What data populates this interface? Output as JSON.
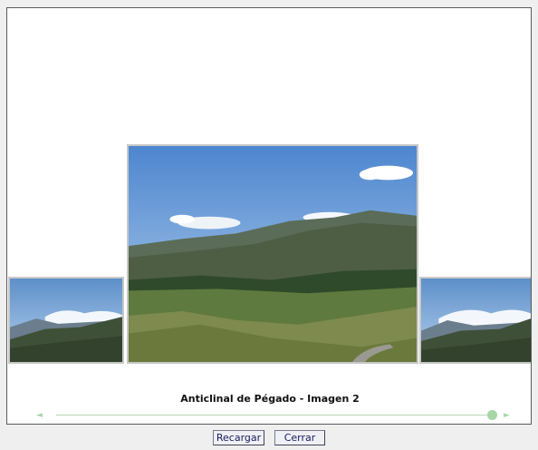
{
  "viewer": {
    "caption": "Anticlinal de Pégado - Imagen 2",
    "slider": {
      "position_fraction": 1.0,
      "prev_arrow": "◄",
      "next_arrow": "►"
    }
  },
  "photos": {
    "main": {
      "subject": "mountain landscape"
    },
    "prev": {
      "subject": "mountain landscape"
    },
    "next": {
      "subject": "mountain landscape"
    }
  },
  "buttons": {
    "reload_label": "Recargar",
    "close_label": "Cerrar"
  },
  "colors": {
    "slider_accent": "#a6d6a6",
    "button_text": "#1a1a5a"
  }
}
